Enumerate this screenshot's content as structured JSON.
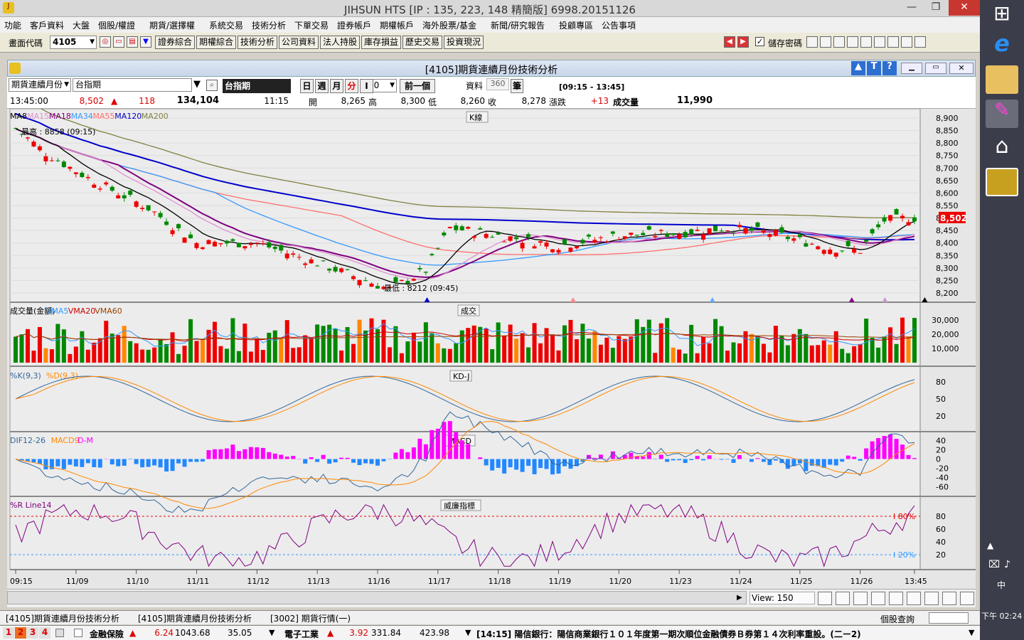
{
  "window": {
    "title": "JIHSUN HTS     [IP : 135, 223, 148 精簡版] 6998.20151126",
    "min": "—",
    "max": "❐",
    "close": "✕"
  },
  "menu": [
    "功能",
    "客戶資料",
    "大盤",
    "個股/權證",
    "期貨/選擇權",
    "系統交易",
    "技術分析",
    "下單交易",
    "證券帳戶",
    "期權帳戶",
    "海外股票/基金",
    "新聞/研究報告",
    "投顧專區",
    "公告事項"
  ],
  "toolbar": {
    "code_label": "畫面代碼",
    "code_value": "4105",
    "buttons": [
      "證券綜合",
      "期權綜合",
      "技術分析",
      "公司資料",
      "法人持股",
      "庫存損益",
      "歷史交易",
      "投資現況"
    ],
    "save_pw": "儲存密碼",
    "save_checked": "✓"
  },
  "panel": {
    "title": "[4105]期貨連續月份技術分析",
    "sel1": "期貨連續月份",
    "sel2": "台指期",
    "name": "台指期",
    "periods": [
      "日",
      "週",
      "月",
      "分",
      "I"
    ],
    "interval": "30",
    "prev": "前一個",
    "data_label": "資料",
    "data_count": "360",
    "bi": "筆",
    "timerange": "[09:15 - 13:45]"
  },
  "quote": {
    "time": "13:45:00",
    "price": "8,502",
    "arrow": "▲",
    "change": "118",
    "volume": "134,104",
    "t2": "11:15",
    "open_l": "開",
    "open": "8,265",
    "high_v": "8,300",
    "high_l": "高",
    "low_v": "8,260",
    "low_l": "低",
    "close_v": "8,278",
    "close_l": "收",
    "chg_l": "漲跌",
    "chg": "+13",
    "vol_l": "成交量",
    "vol": "11,990"
  },
  "ma_legend": [
    {
      "t": "MA8",
      "c": "#000000"
    },
    {
      "t": "MA15",
      "c": "#e090d0"
    },
    {
      "t": "MA18",
      "c": "#800080"
    },
    {
      "t": "MA34",
      "c": "#3399ff"
    },
    {
      "t": "MA55",
      "c": "#ff7070"
    },
    {
      "t": "MA120",
      "c": "#0000cc"
    },
    {
      "t": "MA200",
      "c": "#808040"
    }
  ],
  "vol_legend": [
    {
      "t": "成交量(金額)",
      "c": "#000"
    },
    {
      "t": "VMA5",
      "c": "#3399ff"
    },
    {
      "t": "VMA20",
      "c": "#cc0000"
    },
    {
      "t": "VMA60",
      "c": "#994400"
    }
  ],
  "kd_legend": [
    {
      "t": "%K(9,3)",
      "c": "#336699"
    },
    {
      "t": "%D(9,3)",
      "c": "#ff8800"
    }
  ],
  "macd_legend": [
    {
      "t": "DIF12-26",
      "c": "#336699"
    },
    {
      "t": "MACD9",
      "c": "#ff8800"
    },
    {
      "t": "D-M",
      "c": "#ff00ff"
    }
  ],
  "wr_legend": [
    {
      "t": "%R Line14",
      "c": "#800080"
    }
  ],
  "pane_titles": {
    "k": "K線",
    "vol": "成交",
    "kd": "KD-J",
    "macd": "MACD",
    "wr": "威廉指標"
  },
  "annotations": {
    "high": "最高 : 8858 (09:15)",
    "low": "最低 : 8212 (09:45)",
    "wr80": "80%",
    "wr20": "20%",
    "cur_price": "8,502"
  },
  "view_label": "View: 150",
  "tabs": [
    "[4105]期貨連續月份技術分析",
    "[4105]期貨連續月份技術分析",
    "[3002]  期貨行情(一)"
  ],
  "search_label": "個股查詢",
  "ticker": {
    "nums": [
      "1",
      "2",
      "3",
      "4"
    ],
    "a_name": "金融保險",
    "a_arrow": "▲",
    "a_chg": "6.24",
    "a_val": "1043.68",
    "a_vol": "35.05",
    "b_name": "電子工業",
    "b_arrow": "▲",
    "b_chg": "3.92",
    "b_val": "331.84",
    "b_vol": "423.98",
    "news": "[14:15]  陽信銀行：陽信商業銀行１０１年度第一期次順位金融債券Ｂ券第１４次利率重設。(二ー2)"
  },
  "taskbar": {
    "up": "▲",
    "time": "下午 02:24",
    "ime": "中"
  },
  "chart_data": {
    "type": "candlestick",
    "x_tick_labels": [
      "09:15",
      "11/09",
      "11/10",
      "11/11",
      "11/12",
      "11/13",
      "11/16",
      "11/17",
      "11/18",
      "11/19",
      "11/20",
      "11/23",
      "11/24",
      "11/25",
      "11/26",
      "13:45"
    ],
    "price_ticks": [
      8900,
      8850,
      8800,
      8750,
      8700,
      8650,
      8600,
      8550,
      8500,
      8450,
      8400,
      8350,
      8300,
      8250,
      8200
    ],
    "price_ylim": [
      8180,
      8920
    ],
    "vol_ticks": [
      10000,
      20000,
      30000
    ],
    "vol_ylim": [
      0,
      40000
    ],
    "kd_ticks": [
      20,
      50,
      80
    ],
    "kd_ylim": [
      0,
      100
    ],
    "macd_ticks": [
      40,
      20,
      0,
      -20,
      -40,
      -60
    ],
    "macd_ylim": [
      -70,
      50
    ],
    "wr_ticks": [
      20,
      40,
      60,
      80
    ],
    "wr_ylim": [
      0,
      100
    ],
    "close_key_points": [
      [
        0,
        8858
      ],
      [
        5,
        8760
      ],
      [
        12,
        8660
      ],
      [
        22,
        8540
      ],
      [
        30,
        8400
      ],
      [
        40,
        8400
      ],
      [
        50,
        8320
      ],
      [
        62,
        8215
      ],
      [
        68,
        8290
      ],
      [
        72,
        8460
      ],
      [
        80,
        8430
      ],
      [
        90,
        8390
      ],
      [
        100,
        8430
      ],
      [
        110,
        8440
      ],
      [
        118,
        8460
      ],
      [
        125,
        8440
      ],
      [
        135,
        8380
      ],
      [
        140,
        8370
      ],
      [
        144,
        8490
      ],
      [
        149,
        8502
      ]
    ]
  }
}
